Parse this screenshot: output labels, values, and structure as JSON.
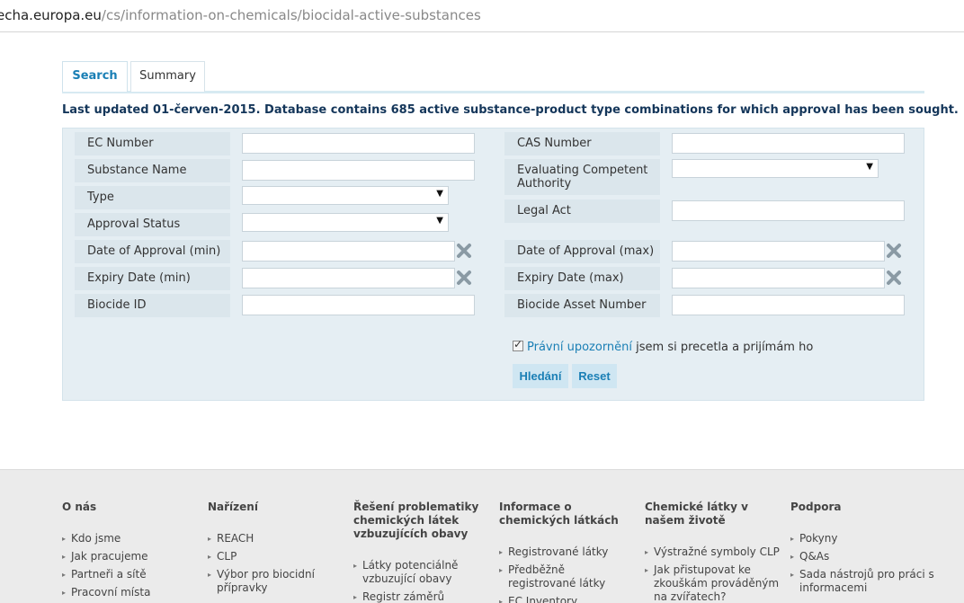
{
  "browser": {
    "url_host": "echa.europa.eu",
    "url_path": "/cs/information-on-chemicals/biocidal-active-substances"
  },
  "tabs": [
    {
      "label": "Search",
      "active": true
    },
    {
      "label": "Summary",
      "active": false
    }
  ],
  "updated_text": "Last updated 01-červen-2015. Database contains 685 active substance-product type combinations for which approval has been sought.",
  "form": {
    "left": {
      "ec_number": "EC Number",
      "substance_name": "Substance Name",
      "type": "Type",
      "approval_status": "Approval Status",
      "date_approval_min": "Date of Approval (min)",
      "expiry_min": "Expiry Date (min)",
      "biocide_id": "Biocide ID"
    },
    "right": {
      "cas_number": "CAS Number",
      "eca_line1": "Evaluating Competent",
      "eca_line2": "Authority",
      "legal_act": "Legal Act",
      "date_approval_max": "Date of Approval (max)",
      "expiry_max": "Expiry Date (max)",
      "biocide_asset": "Biocide Asset Number"
    },
    "values": {
      "ec_number": "",
      "substance_name": "",
      "type": "",
      "approval_status": "",
      "date_approval_min": "",
      "expiry_min": "",
      "biocide_id": "",
      "cas_number": "",
      "eca": "",
      "legal_act": "",
      "date_approval_max": "",
      "expiry_max": "",
      "biocide_asset": ""
    },
    "consent_link": "Právní upozornění",
    "consent_text": " jsem si precetla a prijímám ho",
    "consent_checked": true,
    "search_button": "Hledání",
    "reset_button": "Reset"
  },
  "footer": [
    {
      "heading": "O nás",
      "items": [
        "Kdo jsme",
        "Jak pracujeme",
        "Partneři a sítě",
        "Pracovní místa"
      ]
    },
    {
      "heading": "Nařízení",
      "items": [
        "REACH",
        "CLP",
        "Výbor pro biocidní přípravky"
      ]
    },
    {
      "heading": "Řešení problematiky chemických látek vzbuzujících obavy",
      "items": [
        "Látky potenciálně vzbuzující obavy",
        "Registr záměrů"
      ]
    },
    {
      "heading": "Informace o chemických látkách",
      "items": [
        "Registrované látky",
        "Předběžně registrované látky",
        "EC Inventory"
      ]
    },
    {
      "heading": "Chemické látky v našem životě",
      "items": [
        "Výstražné symboly CLP",
        "Jak přistupovat ke zkouškám prováděným na zvířatech?"
      ]
    },
    {
      "heading": "Podpora",
      "items": [
        "Pokyny",
        "Q&As",
        "Sada nástrojů pro práci s informacemi"
      ]
    }
  ]
}
